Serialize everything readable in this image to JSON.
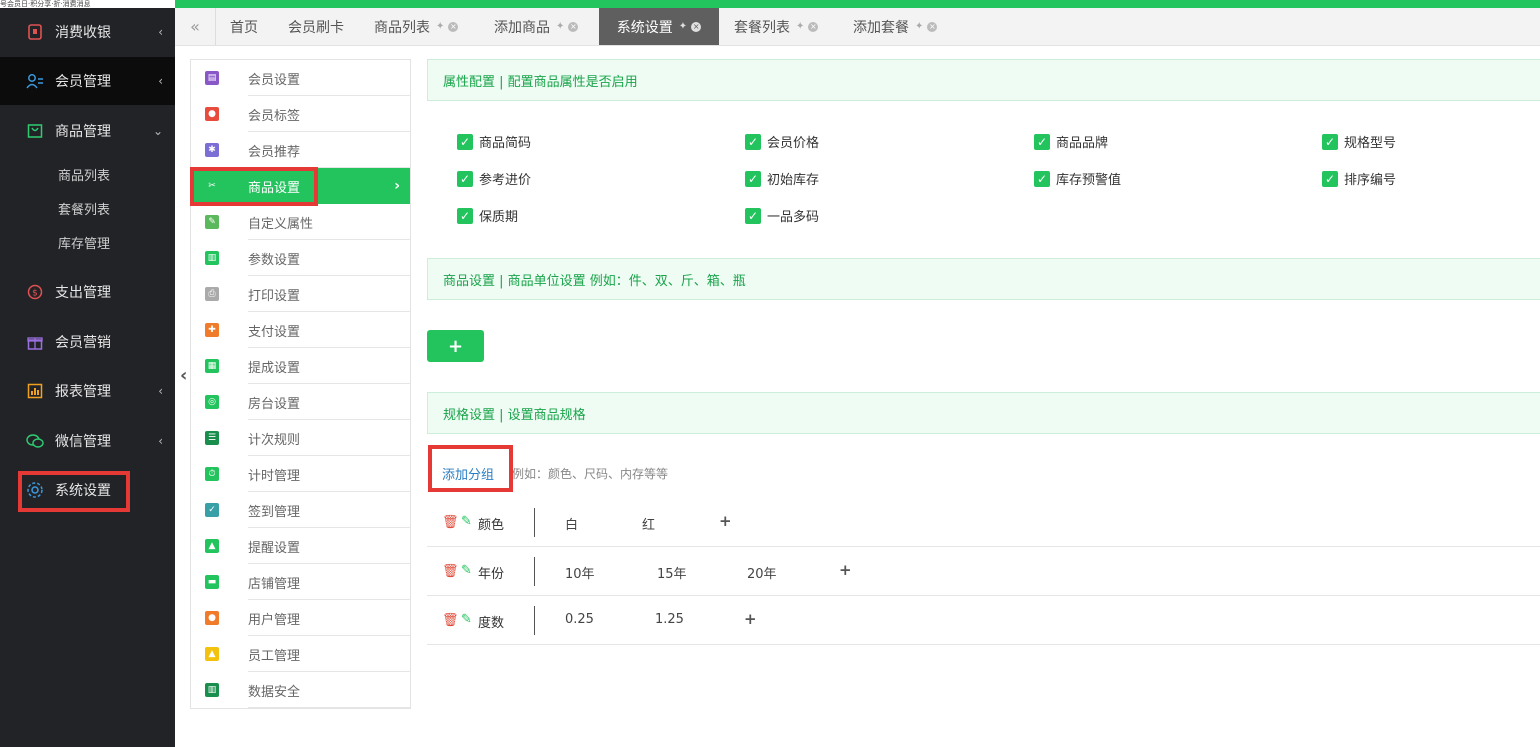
{
  "ticker_text": "号会员日·积分享·折·消费消息",
  "sidebar": {
    "items": [
      {
        "label": "消费收银",
        "arrow": "‹"
      },
      {
        "label": "会员管理",
        "arrow": "‹"
      },
      {
        "label": "商品管理",
        "arrow": "⌄"
      },
      {
        "label": "支出管理"
      },
      {
        "label": "会员营销"
      },
      {
        "label": "报表管理",
        "arrow": "‹"
      },
      {
        "label": "微信管理",
        "arrow": "‹"
      },
      {
        "label": "系统设置"
      }
    ],
    "sub_items": [
      "商品列表",
      "套餐列表",
      "库存管理"
    ]
  },
  "tabs": [
    {
      "label": "首页"
    },
    {
      "label": "会员刷卡"
    },
    {
      "label": "商品列表",
      "pin": "✦",
      "close": "×"
    },
    {
      "label": "添加商品",
      "pin": "✦",
      "close": "×"
    },
    {
      "label": "系统设置",
      "pin": "✦",
      "close": "×"
    },
    {
      "label": "套餐列表",
      "pin": "✦",
      "close": "×"
    },
    {
      "label": "添加套餐",
      "pin": "✦",
      "close": "×"
    }
  ],
  "settings_menu": [
    {
      "label": "会员设置",
      "color": "#8a57c9"
    },
    {
      "label": "会员标签",
      "color": "#e74c3c"
    },
    {
      "label": "会员推荐",
      "color": "#7b6fd6"
    },
    {
      "label": "商品设置",
      "color": "#23c45e"
    },
    {
      "label": "自定义属性",
      "color": "#5cb85c"
    },
    {
      "label": "参数设置",
      "color": "#23c45e"
    },
    {
      "label": "打印设置",
      "color": "#aaaaaa"
    },
    {
      "label": "支付设置",
      "color": "#f07b2b"
    },
    {
      "label": "提成设置",
      "color": "#23c45e"
    },
    {
      "label": "房台设置",
      "color": "#23c45e"
    },
    {
      "label": "计次规则",
      "color": "#1a8f4d"
    },
    {
      "label": "计时管理",
      "color": "#23c45e"
    },
    {
      "label": "签到管理",
      "color": "#3aa0a8"
    },
    {
      "label": "提醒设置",
      "color": "#23c45e"
    },
    {
      "label": "店铺管理",
      "color": "#23c45e"
    },
    {
      "label": "用户管理",
      "color": "#f07b2b"
    },
    {
      "label": "员工管理",
      "color": "#f2c20f"
    },
    {
      "label": "数据安全",
      "color": "#1a8f4d"
    }
  ],
  "main": {
    "attr_header": "属性配置 | 配置商品属性是否启用",
    "attributes": [
      "商品简码",
      "会员价格",
      "商品品牌",
      "规格型号",
      "参考进价",
      "初始库存",
      "库存预警值",
      "排序编号",
      "保质期",
      "一品多码"
    ],
    "unit_header": "商品设置 | 商品单位设置    例如：件、双、斤、箱、瓶",
    "add_button": "+",
    "spec_header": "规格设置 | 设置商品规格",
    "add_group": "添加分组",
    "add_group_hint": "例如：颜色、尺码、内存等等",
    "specs": [
      {
        "name": "颜色",
        "values": [
          "白",
          "红"
        ]
      },
      {
        "name": "年份",
        "values": [
          "10年",
          "15年",
          "20年"
        ]
      },
      {
        "name": "度数",
        "values": [
          "0.25",
          "1.25"
        ]
      }
    ]
  },
  "colors": {
    "accent": "#23c45e",
    "sidebar_bg": "#222327",
    "highlight": "#e53935"
  }
}
